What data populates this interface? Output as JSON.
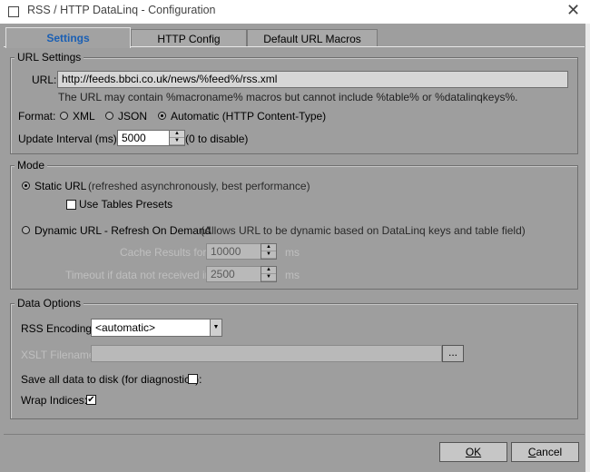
{
  "window": {
    "title": "RSS / HTTP DataLinq - Configuration"
  },
  "tabs": [
    {
      "label": "Settings",
      "active": true
    },
    {
      "label": "HTTP Config",
      "active": false
    },
    {
      "label": "Default URL Macros",
      "active": false
    }
  ],
  "url_settings": {
    "title": "URL Settings",
    "url_label": "URL:",
    "url_value": "http://feeds.bbci.co.uk/news/%feed%/rss.xml",
    "hint": "The URL may contain %macroname% macros but cannot include %table%  or %datalinqkeys%.",
    "format_label": "Format:",
    "format_options": [
      "XML",
      "JSON",
      "Automatic (HTTP Content-Type)"
    ],
    "format_selected": "Automatic (HTTP Content-Type)",
    "update_label": "Update Interval (ms):",
    "update_value": "5000",
    "update_note": "(0 to disable)"
  },
  "mode": {
    "title": "Mode",
    "static_label": "Static URL",
    "static_note": "(refreshed asynchronously, best performance)",
    "use_tables_label": "Use Tables Presets",
    "use_tables_checked": false,
    "dynamic_label": "Dynamic URL - Refresh On Demand",
    "dynamic_note": "(Allows URL to be dynamic based on DataLinq keys and table field)",
    "selected": "static",
    "cache_label": "Cache Results for:",
    "cache_value": "10000",
    "cache_unit": "ms",
    "timeout_label": "Timeout if data not received in:",
    "timeout_value": "2500",
    "timeout_unit": "ms"
  },
  "data_options": {
    "title": "Data Options",
    "encoding_label": "RSS Encoding:",
    "encoding_value": "<automatic>",
    "xslt_label": "XSLT Filename:",
    "xslt_value": "",
    "browse_label": "...",
    "save_label": "Save all data to disk (for diagnostics):",
    "save_checked": false,
    "wrap_label": "Wrap Indices:",
    "wrap_checked": true
  },
  "buttons": {
    "ok": "OK",
    "cancel": "Cancel"
  },
  "colors": {
    "accent": "#1a5fb4",
    "dialog_bg": "#9e9e9e"
  }
}
